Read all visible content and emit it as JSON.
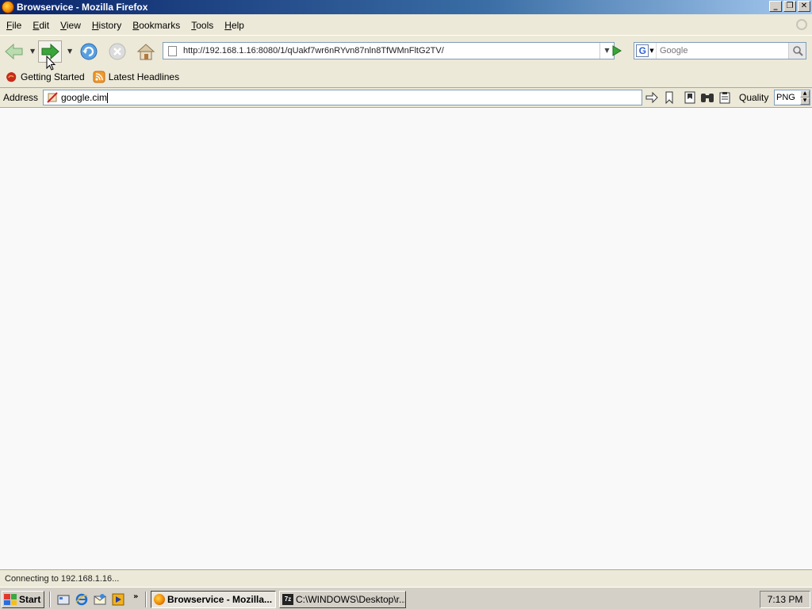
{
  "window": {
    "title": "Browservice - Mozilla Firefox",
    "controls": {
      "minimize": "_",
      "maximize": "❐",
      "close": "✕"
    }
  },
  "menubar": {
    "items": [
      {
        "label": "File",
        "accel": "F",
        "rest": "ile"
      },
      {
        "label": "Edit",
        "accel": "E",
        "rest": "dit"
      },
      {
        "label": "View",
        "accel": "V",
        "rest": "iew"
      },
      {
        "label": "History",
        "accel": "H",
        "rest": "istory"
      },
      {
        "label": "Bookmarks",
        "accel": "B",
        "rest": "ookmarks"
      },
      {
        "label": "Tools",
        "accel": "T",
        "rest": "ools"
      },
      {
        "label": "Help",
        "accel": "H",
        "rest": "elp"
      }
    ]
  },
  "navigation": {
    "url": "http://192.168.1.16:8080/1/qUakf7wr6nRYvn87nln8TfWMnFltG2TV/",
    "search_placeholder": "Google"
  },
  "bookmarks": {
    "items": [
      {
        "label": "Getting Started",
        "icon": "firefox-icon"
      },
      {
        "label": "Latest Headlines",
        "icon": "rss-feed-icon"
      }
    ]
  },
  "addressbar": {
    "label": "Address",
    "value": "google.cim",
    "quality_label": "Quality",
    "quality_value": "PNG"
  },
  "status": {
    "text": "Connecting to 192.168.1.16..."
  },
  "taskbar": {
    "start_label": "Start",
    "quicklaunch_more": "»",
    "tasks": [
      {
        "label": "Browservice - Mozilla...",
        "active": true
      },
      {
        "label": "C:\\WINDOWS\\Desktop\\r...",
        "active": false
      }
    ],
    "clock": "7:13 PM"
  },
  "colors": {
    "titlebar_start": "#0a246a",
    "titlebar_end": "#a6caf0",
    "chrome": "#ece9d8",
    "content": "#f9f9f9",
    "nav_green": "#3aa63a"
  }
}
